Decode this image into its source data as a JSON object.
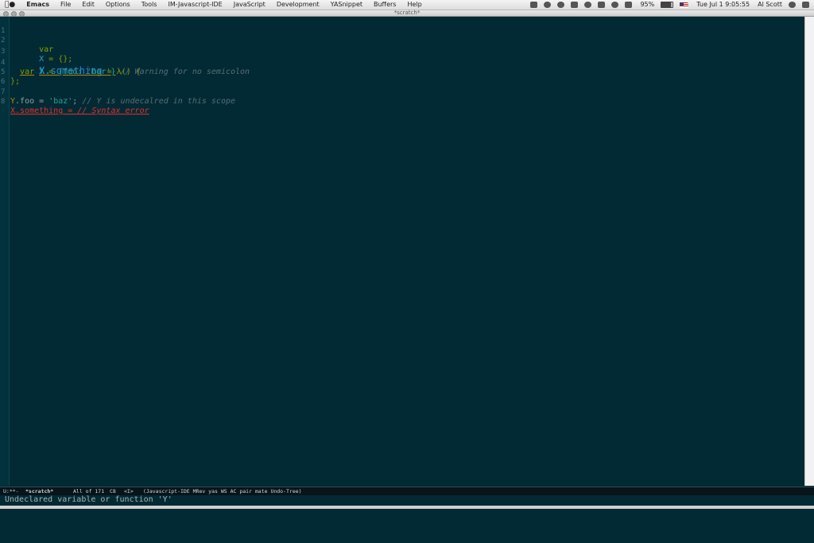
{
  "menubar": {
    "app_name": "Emacs",
    "menus": [
      "File",
      "Edit",
      "Options",
      "Tools",
      "IM-Javascript-IDE",
      "JavaScript",
      "Development",
      "YASnippet",
      "Buffers",
      "Help"
    ],
    "battery": "95%",
    "clock": "Tue Jul 1  9:05:55",
    "user": "Al Scott"
  },
  "window": {
    "title": "*scratch*"
  },
  "editor": {
    "line_numbers": [
      "1",
      "2",
      "3",
      "4",
      "5",
      "6",
      "7",
      "8"
    ],
    "line1": {
      "kw": "var",
      "name": "X",
      "op": " = ",
      "rest": "{};"
    },
    "line3": {
      "obj": "X.",
      "prop": "something",
      "op": " = ",
      "rest": "λ() {"
    },
    "line4": {
      "indent": "  ",
      "kw": "var",
      "name": "Y",
      "op": " = ",
      "obj": "{foo: 'bar'}",
      "comment": "// Warning for no semicolon"
    },
    "line5": {
      "text": "};"
    },
    "line7": {
      "obj": "Y",
      "prop": ".foo",
      "op": " = ",
      "str": "'baz'",
      "semi": ";",
      "comment": "// Y is undecalred in this scope"
    },
    "line8": {
      "code": "X.something = ",
      "comment": "// Syntax error"
    }
  },
  "modeline": {
    "status": "U:**-",
    "buffer": "*scratch*",
    "position": "All of 171",
    "column": "C8",
    "state": "<I>",
    "modes": "(Javascript-IDE MRev yas WS AC pair mate Undo-Tree)"
  },
  "echo_area": {
    "message": "Undeclared variable or function 'Y'"
  }
}
